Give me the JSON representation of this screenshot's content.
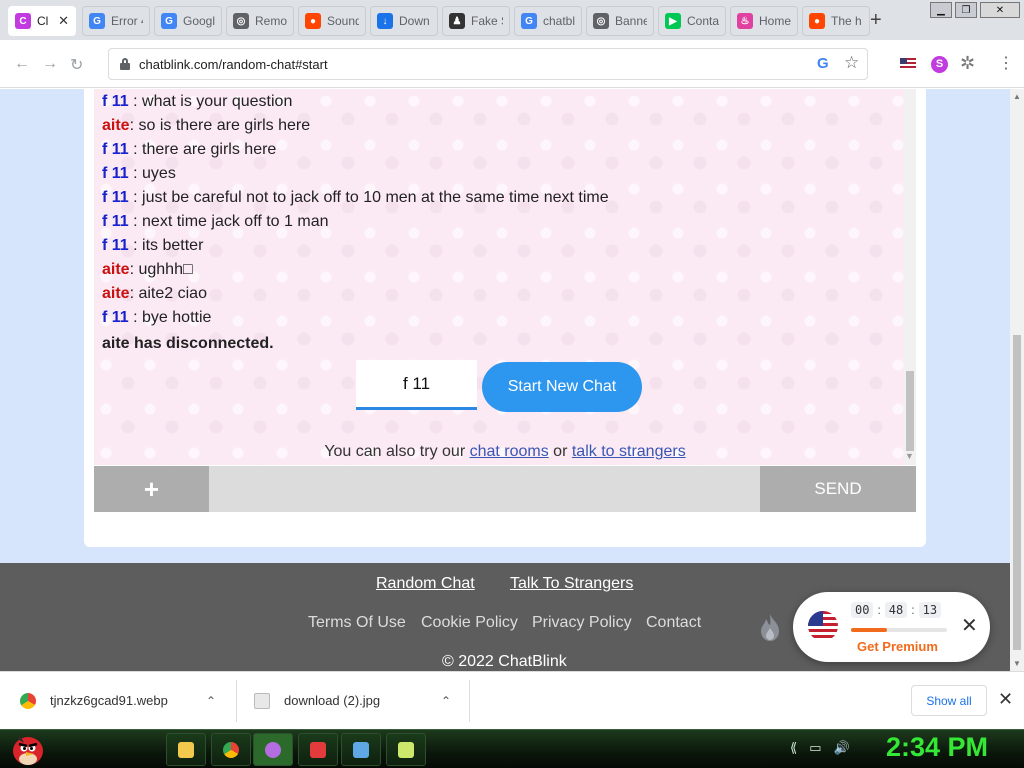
{
  "browser": {
    "tabs": [
      {
        "label": "Cl",
        "color": "#c23be0",
        "glyph": "C",
        "active": true
      },
      {
        "label": "Error 4",
        "color": "#4285f4",
        "glyph": "G"
      },
      {
        "label": "Googl",
        "color": "#4285f4",
        "glyph": "G"
      },
      {
        "label": "Remo",
        "color": "#5f6368",
        "glyph": "◎"
      },
      {
        "label": "Sound",
        "color": "#ff4500",
        "glyph": "●"
      },
      {
        "label": "Down",
        "color": "#1a73e8",
        "glyph": "↓"
      },
      {
        "label": "Fake S",
        "color": "#333333",
        "glyph": "♟"
      },
      {
        "label": "chatbl",
        "color": "#4285f4",
        "glyph": "G"
      },
      {
        "label": "Banne",
        "color": "#5f6368",
        "glyph": "◎"
      },
      {
        "label": "Conta",
        "color": "#00c853",
        "glyph": "▶"
      },
      {
        "label": "Home",
        "color": "#e040a0",
        "glyph": "♨"
      },
      {
        "label": "The h",
        "color": "#ff4500",
        "glyph": "●"
      }
    ],
    "tab_close_glyph": "✕",
    "new_tab_glyph": "+",
    "window_controls": {
      "minimize": "▁",
      "maximize": "❐",
      "close": "✕"
    },
    "nav": {
      "back": "←",
      "forward": "→",
      "reload": "↻"
    },
    "url": "chatblink.com/random-chat#start",
    "omnibox_g": "G",
    "star": "☆",
    "extension_s": "S",
    "puzzle": "✲",
    "menu": "⋮"
  },
  "chat": {
    "messages": [
      {
        "sender": "f 11",
        "role": "stranger",
        "sep": " : ",
        "text": "what is your question"
      },
      {
        "sender": "aite",
        "role": "me",
        "sep": ": ",
        "text": "so is there are girls here"
      },
      {
        "sender": "f 11",
        "role": "stranger",
        "sep": " : ",
        "text": "there are girls here"
      },
      {
        "sender": "f 11",
        "role": "stranger",
        "sep": " : ",
        "text": "uyes"
      },
      {
        "sender": "f 11",
        "role": "stranger",
        "sep": " : ",
        "text": "just be careful not to jack off to 10 men at the same time next time"
      },
      {
        "sender": "f 11",
        "role": "stranger",
        "sep": " : ",
        "text": "next time jack off to 1 man"
      },
      {
        "sender": "f 11",
        "role": "stranger",
        "sep": " : ",
        "text": "its better"
      },
      {
        "sender": "aite",
        "role": "me",
        "sep": ": ",
        "text": "ughhh□"
      },
      {
        "sender": "aite",
        "role": "me",
        "sep": ": ",
        "text": "aite2 ciao"
      },
      {
        "sender": "f 11",
        "role": "stranger",
        "sep": " : ",
        "text": "bye hottie"
      }
    ],
    "system_message": "aite has disconnected.",
    "name_field_value": "f 11",
    "new_chat_label": "Start New Chat",
    "also_try_prefix": "You can also try our ",
    "chat_rooms_link": "chat rooms",
    "also_try_or": " or ",
    "talk_link": "talk to strangers",
    "plus_label": "+",
    "send_label": "SEND",
    "colors": {
      "stranger": "#1a22c9",
      "me": "#cc1111",
      "accent": "#2d96ee"
    }
  },
  "footer": {
    "random_chat": "Random Chat",
    "talk_to_strangers": "Talk To Strangers",
    "terms": "Terms Of Use",
    "cookie": "Cookie Policy",
    "privacy": "Privacy Policy",
    "contact": "Contact",
    "copyright": "© 2022 ChatBlink"
  },
  "promo": {
    "hours": "00",
    "minutes": "48",
    "seconds": "13",
    "separator": ":",
    "progress_fraction": 0.38,
    "cta": "Get Premium",
    "close": "✕"
  },
  "downloads": {
    "items": [
      {
        "name": "tjnzkz6gcad91.webp"
      },
      {
        "name": "download (2).jpg"
      }
    ],
    "chevron": "⌃",
    "show_all": "Show all",
    "close": "✕"
  },
  "taskbar": {
    "clock": "2:34 PM",
    "tray": [
      "⟪",
      "▭",
      "🔊",
      "▮"
    ]
  }
}
